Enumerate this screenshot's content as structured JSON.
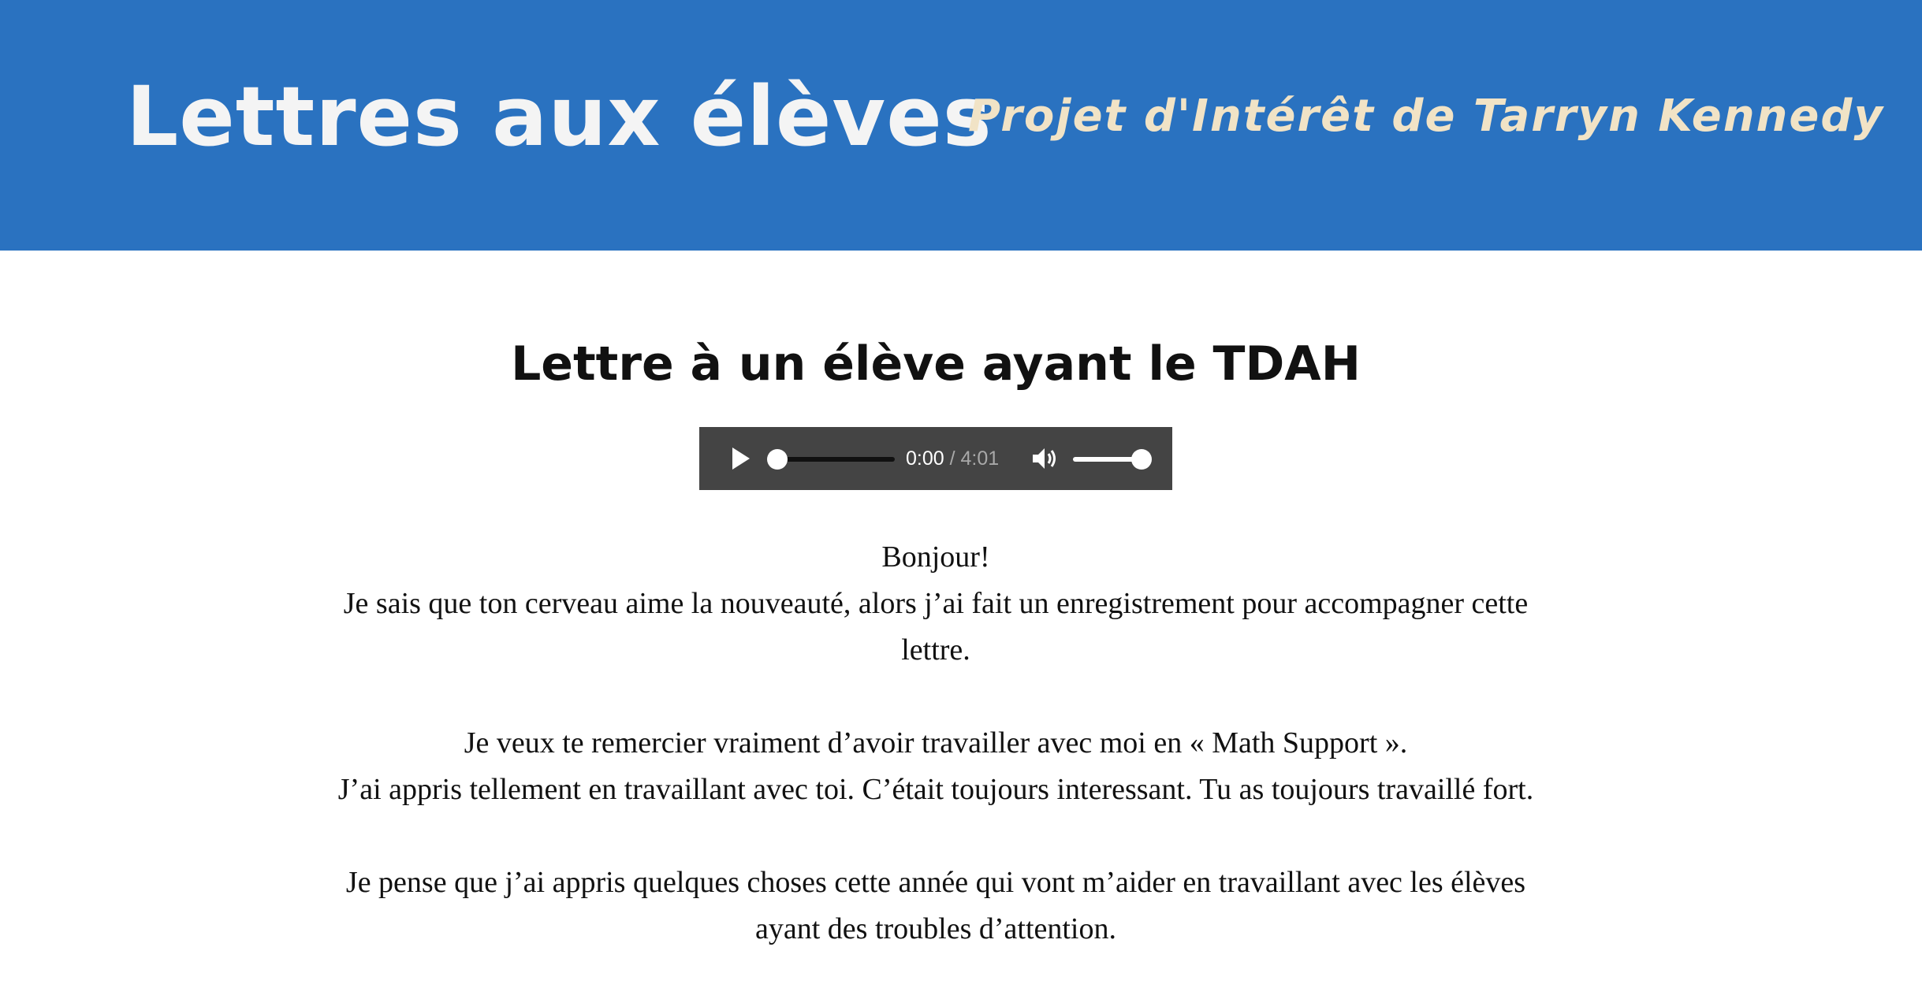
{
  "header": {
    "site_title": "Lettres aux élèves",
    "subtitle": "Projet d'Intérêt de Tarryn Kennedy",
    "background_color": "#2a72c0"
  },
  "main": {
    "letter_title": "Lettre à un élève ayant le TDAH",
    "audio": {
      "current_time": "0:00",
      "separator": "/",
      "duration": "4:01",
      "progress": 0.0,
      "volume": 1.0
    },
    "paragraphs": [
      {
        "lines": [
          "Bonjour!",
          "Je sais que ton cerveau aime la nouveauté, alors j’ai fait un enregistrement pour accompagner cette lettre."
        ]
      },
      {
        "lines": [
          "Je veux te remercier vraiment d’avoir travailler avec moi en « Math Support ».",
          "J’ai appris tellement en travaillant avec toi. C’était toujours interessant. Tu as toujours travaillé fort."
        ]
      },
      {
        "lines": [
          "Je pense que j’ai appris quelques choses cette année qui vont m’aider en travaillant avec les élèves ayant des troubles d’attention."
        ]
      }
    ]
  }
}
